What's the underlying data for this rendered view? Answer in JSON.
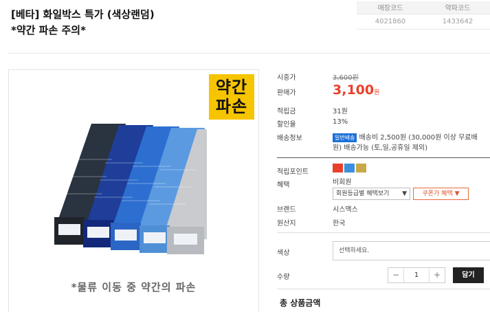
{
  "title": {
    "line1": "[베타] 화일박스 특가 (색상랜덤)",
    "line2": "*약간 파손 주의*"
  },
  "codes": {
    "headers": [
      "매장코드",
      "약파코드"
    ],
    "values": [
      "4021860",
      "1433642"
    ]
  },
  "image": {
    "badge_line1": "약간",
    "badge_line2": "파손",
    "caption": "*물류 이동 중 약간의 파손"
  },
  "info": {
    "list_price_label": "시중가",
    "list_price": "3,600원",
    "sale_price_label": "판매가",
    "sale_price": "3,100",
    "sale_unit": "원",
    "points_label": "적립금",
    "points": "31원",
    "discount_label": "할인율",
    "discount": "13%",
    "shipping_label": "배송정보",
    "shipping_badge": "일반배송",
    "shipping_line1": "배송비 2,500원 (30,000원 이상 무료배",
    "shipping_line2": "원) 배송가능 (토,일,공휴일 제외)",
    "save_points_label": "적립포인트",
    "benefit_label": "혜택",
    "benefit_value": "비회원",
    "grade_select": "회원등급별 혜택보기",
    "coupon_button": "쿠폰가 혜택",
    "brand_label": "브랜드",
    "brand_value": "시스맥스",
    "origin_label": "원산지",
    "origin_value": "한국"
  },
  "option": {
    "label": "색상",
    "placeholder": "선택하세요."
  },
  "quantity": {
    "label": "수량",
    "value": "1",
    "minus": "−",
    "plus": "+",
    "cart_button": "담기"
  },
  "total_label": "총 상품금액",
  "colors": {
    "accent": "#e8402a",
    "badge": "#f7c400",
    "ship": "#1b6fd8"
  }
}
